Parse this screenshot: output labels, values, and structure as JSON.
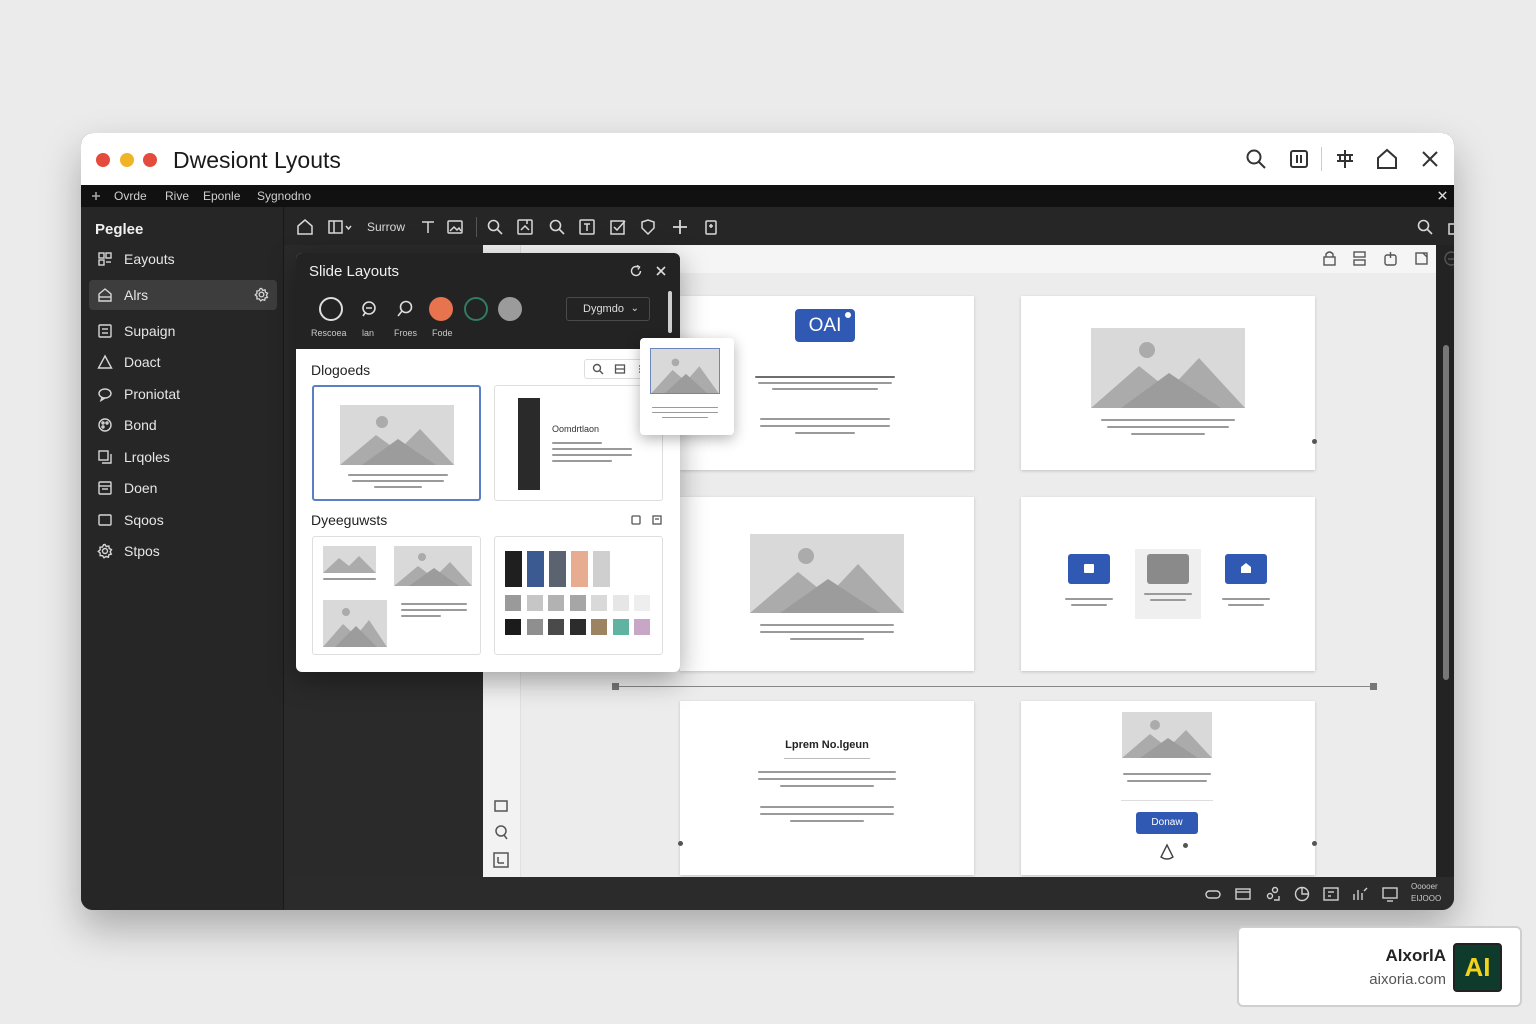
{
  "window": {
    "title": "Dwesiont Lyouts",
    "traffic_lights": [
      "#e54b3c",
      "#f0b429",
      "#e54b3c"
    ],
    "title_icons": [
      "search-icon",
      "panel-icon",
      "crop-icon",
      "home-icon",
      "close-icon"
    ]
  },
  "menubar": {
    "items": [
      "Ovrde",
      "Rive",
      "Eponle",
      "Sygnodno"
    ]
  },
  "sidebar": {
    "heading": "Peglee",
    "items": [
      {
        "label": "Eayouts",
        "icon": "layouts-icon"
      },
      {
        "label": "Alrs",
        "icon": "home-icon",
        "active": true
      },
      {
        "label": "Supaign",
        "icon": "list-icon"
      },
      {
        "label": "Doact",
        "icon": "triangle-icon"
      },
      {
        "label": "Proniotat",
        "icon": "chat-icon"
      },
      {
        "label": "Bond",
        "icon": "palette-icon"
      },
      {
        "label": "Lrqoles",
        "icon": "copy-icon"
      },
      {
        "label": "Doen",
        "icon": "document-icon"
      },
      {
        "label": "Sqoos",
        "icon": "square-icon"
      },
      {
        "label": "Stpos",
        "icon": "gear-icon"
      }
    ]
  },
  "toolbar": {
    "label": "Surrow"
  },
  "dialog": {
    "title": "Slide Layouts",
    "swatches": [
      {
        "label": "Rescoea",
        "style": "outline"
      },
      {
        "label": "lan",
        "style": "chat"
      },
      {
        "label": "Froes",
        "style": "bubble"
      },
      {
        "label": "Fode",
        "color": "#e8734f"
      },
      {
        "label": "",
        "color": "#2f7d62"
      },
      {
        "label": "",
        "color": "#9b9b9b"
      }
    ],
    "select_value": "Dygmdo",
    "section1_title": "Dlogoeds",
    "section2_title": "Dyeeguwsts",
    "card_text": "Oomdrtlaon",
    "palette_colors": [
      [
        "#1f1f1f",
        "#3b5a92",
        "#5c6370",
        "#e8ad91",
        "#cfcfcf"
      ],
      [
        "#9a9a9a",
        "#c6c6c6",
        "#b2b2b2",
        "#a6a6a6",
        "#d9d9d9",
        "#e6e6e6",
        "#eeeeee"
      ],
      [
        "#1b1b1b",
        "#8f8f8f",
        "#4a4a4a",
        "#2c2c2c",
        "#9c8462",
        "#5fb3a0",
        "#c7a6c6"
      ]
    ]
  },
  "slides": {
    "logo_text": "OAI",
    "title5": "Lprem No.lgeun",
    "button6": "Donaw"
  },
  "status": {
    "text_line1": "Ooooer",
    "text_line2": "EIJOOO"
  },
  "branding": {
    "name": "AlxorlA",
    "url": "aixoria.com",
    "logo": "AI"
  }
}
